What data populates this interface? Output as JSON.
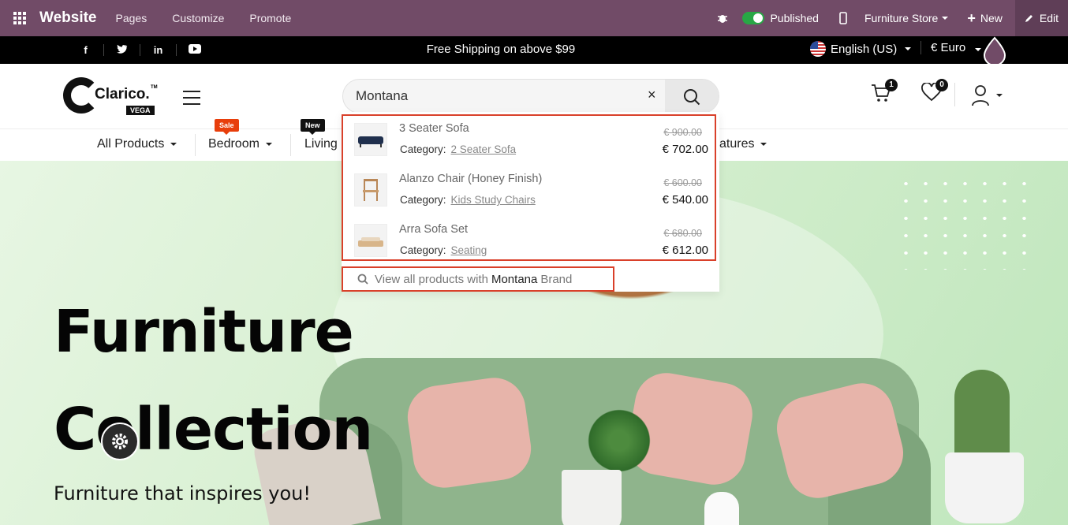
{
  "admin_bar": {
    "brand": "Website",
    "menus": [
      "Pages",
      "Customize",
      "Promote"
    ],
    "published_label": "Published",
    "website_switcher": "Furniture Store",
    "new_label": "New",
    "edit_label": "Edit",
    "bg_color": "#714B67"
  },
  "info_bar": {
    "social": [
      "f",
      "t",
      "in",
      "yt"
    ],
    "shipping_text": "Free Shipping on above $99",
    "language": "English (US)",
    "currency": "€ Euro"
  },
  "header": {
    "logo_text": "Clarico.",
    "logo_tm": "TM",
    "logo_sub": "VEGA",
    "search": {
      "value": "Montana",
      "clear": "×"
    },
    "cart_count": "1",
    "wishlist_count": "0"
  },
  "category_nav": {
    "items": [
      {
        "label": "All Products"
      },
      {
        "label": "Bedroom",
        "tag": "Sale"
      },
      {
        "label": "Living",
        "tag": "New"
      },
      {
        "label": "atures"
      }
    ]
  },
  "search_results": {
    "items": [
      {
        "name": "3 Seater Sofa",
        "category_label": "Category:",
        "category": "2 Seater Sofa",
        "old_price": "€ 900.00",
        "price": "€ 702.00"
      },
      {
        "name": "Alanzo Chair (Honey Finish)",
        "category_label": "Category:",
        "category": "Kids Study Chairs",
        "old_price": "€ 600.00",
        "price": "€ 540.00"
      },
      {
        "name": "Arra Sofa Set",
        "category_label": "Category:",
        "category": "Seating",
        "old_price": "€ 680.00",
        "price": "€ 612.00"
      }
    ],
    "view_all": {
      "prefix": "View all products with",
      "brand": "Montana",
      "suffix": "Brand"
    },
    "highlight_color": "#d9402a"
  },
  "hero": {
    "title_line1": "Furniture",
    "title_line2": "Collection",
    "subtitle": "Furniture that inspires you!"
  }
}
